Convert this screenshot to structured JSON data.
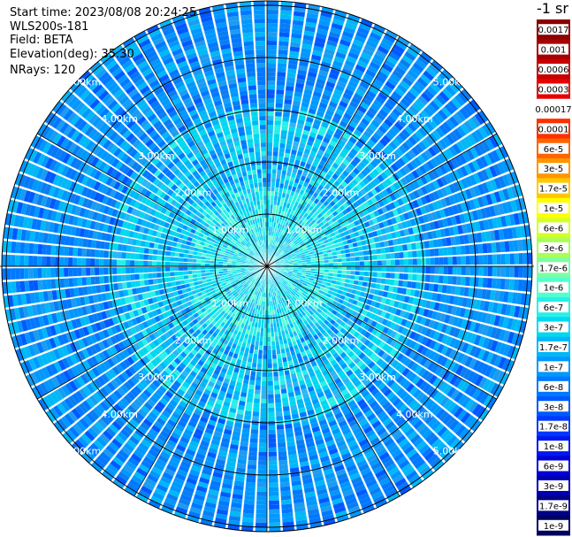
{
  "header": {
    "start_time": "Start time: 2023/08/08 20:24:25",
    "instrument": "WLS200s-181",
    "field": "Field: BETA",
    "elevation": "Elevation(deg): 35.30",
    "nrays": "NRays: 120"
  },
  "colorbar": {
    "unit_label": "-1 sr",
    "levels": [
      {
        "label": "0.0017",
        "color": "#8b0000"
      },
      {
        "label": "0.001",
        "color": "#a80000"
      },
      {
        "label": "0.0006",
        "color": "#c80000"
      },
      {
        "label": "0.0003",
        "color": "#e60000"
      },
      {
        "label": "0.00017",
        "color": "#ffffff"
      },
      {
        "label": "0.0001",
        "color": "#ff3000"
      },
      {
        "label": "6e-5",
        "color": "#ff6400"
      },
      {
        "label": "3e-5",
        "color": "#ff9600"
      },
      {
        "label": "1.7e-5",
        "color": "#ffc800"
      },
      {
        "label": "1e-5",
        "color": "#ffff00"
      },
      {
        "label": "6e-6",
        "color": "#d4ff2a"
      },
      {
        "label": "3e-6",
        "color": "#a8ff56"
      },
      {
        "label": "1.7e-6",
        "color": "#7dffa3"
      },
      {
        "label": "1e-6",
        "color": "#52ffcf"
      },
      {
        "label": "6e-7",
        "color": "#28f0e8"
      },
      {
        "label": "3e-7",
        "color": "#00d8f0"
      },
      {
        "label": "1.7e-7",
        "color": "#00b8f8"
      },
      {
        "label": "1e-7",
        "color": "#0098ff"
      },
      {
        "label": "6e-8",
        "color": "#0078ff"
      },
      {
        "label": "3e-8",
        "color": "#0058ff"
      },
      {
        "label": "1.7e-8",
        "color": "#0038ff"
      },
      {
        "label": "1e-8",
        "color": "#0018f0"
      },
      {
        "label": "6e-9",
        "color": "#0000d8"
      },
      {
        "label": "3e-9",
        "color": "#0000b0"
      },
      {
        "label": "1.7e-9",
        "color": "#000088"
      },
      {
        "label": "1e-9",
        "color": "#000060"
      }
    ]
  },
  "chart_data": {
    "type": "heatmap",
    "projection": "polar (PPI)",
    "field": "BETA",
    "unit": "-1 sr",
    "rings": [
      {
        "range_km": 1,
        "label": "1.00km"
      },
      {
        "range_km": 2,
        "label": "2.00km"
      },
      {
        "range_km": 3,
        "label": "3.00km"
      },
      {
        "range_km": 4,
        "label": "4.00km"
      },
      {
        "range_km": 5,
        "label": "5.00km"
      }
    ],
    "ray_count": 120,
    "spokes_deg": [
      0,
      30,
      60,
      90,
      120,
      150,
      180,
      210,
      240,
      270,
      300,
      330
    ],
    "max_range_km": 5.0,
    "typical_values": {
      "near": "3e-7 to 1e-6",
      "far": "3e-8 to 1e-7"
    }
  },
  "ui": {
    "background": "#ffffff",
    "grid_color": "#000000"
  }
}
